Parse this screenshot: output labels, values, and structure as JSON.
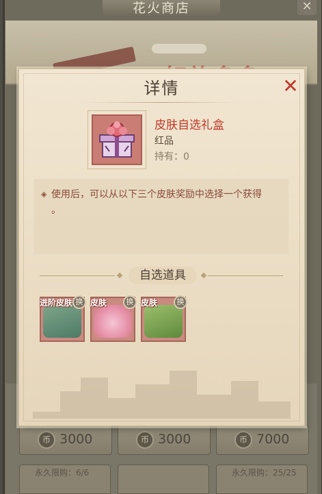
{
  "shop": {
    "title": "花火商店",
    "close_glyph": "✕",
    "banner_text": "好礼多多",
    "price_cards": [
      {
        "coin_glyph": "币",
        "amount": "3000"
      },
      {
        "coin_glyph": "币",
        "amount": "3000"
      },
      {
        "coin_glyph": "币",
        "amount": "7000"
      }
    ],
    "limit_cards": [
      {
        "text": "永久限购：6/6"
      },
      {
        "text": ""
      },
      {
        "text": "永久限购：25/25"
      }
    ]
  },
  "dialog": {
    "title": "详情",
    "close_glyph": "✕",
    "item": {
      "name": "皮肤自选礼盒",
      "quality": "红品",
      "owned": "持有：0"
    },
    "description_bullet": "◈",
    "description": "使用后，可以从以下三个皮肤奖励中选择一个获得",
    "description_tail": "。",
    "section_title": "自选道具",
    "rewards": [
      {
        "tag": "进阶皮肤",
        "badge": "换"
      },
      {
        "tag": "皮肤",
        "badge": "换"
      },
      {
        "tag": "皮肤",
        "badge": "换"
      }
    ]
  },
  "colors": {
    "accent_red": "#c0392b",
    "item_bg": "#c97d74"
  },
  "icons": {
    "dialog_close": "close-icon",
    "coin": "coin-icon",
    "exchange_badge": "exchange-badge-icon",
    "bullet": "diamond-bullet-icon"
  }
}
